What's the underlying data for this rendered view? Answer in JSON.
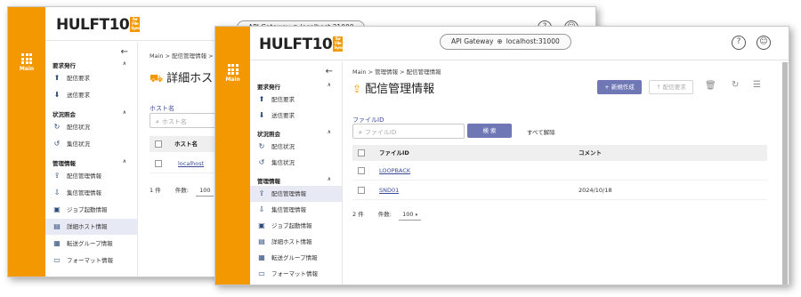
{
  "rail": {
    "label": "Main"
  },
  "app": {
    "logo": "HULFT10",
    "logo_badge": "for File Sync"
  },
  "gateway": {
    "label": "API Gateway",
    "host": "localhost:31000"
  },
  "header_icons": {
    "help": "?",
    "user": "user-icon"
  },
  "back": {
    "gateway_text": "API Gateway  ⊕  localhost:31000",
    "breadcrumb": "Main  >  配信管理情報  >  詳",
    "title": "詳細ホス",
    "search_label": "ホスト名",
    "search_placeholder": "ホスト名",
    "table_header": "ホスト名",
    "row1": "localhost",
    "count": "1 件",
    "per_page_label": "件数:",
    "per_page": "100",
    "sidebar": {
      "sections": [
        {
          "label": "要求発行",
          "items": [
            "配信要求",
            "送信要求"
          ]
        },
        {
          "label": "状況照会",
          "items": [
            "配信状況",
            "集信状況"
          ]
        },
        {
          "label": "管理情報",
          "items": [
            "配信管理情報",
            "集信管理情報",
            "ジョブ起動情報",
            "詳細ホスト情報",
            "転送グループ情報",
            "フォーマット情報"
          ]
        }
      ]
    }
  },
  "front": {
    "breadcrumb": "Main  >  管理情報  >  配信管理情報",
    "title": "配信管理情報",
    "buttons": {
      "new": "+ 新規作成",
      "request": "↑ 配信要求",
      "search": "検 索",
      "clear": "すべて解除"
    },
    "filter": {
      "label": "ファイルID",
      "placeholder": "ファイルID"
    },
    "table": {
      "columns": [
        "ファイルID",
        "コメント"
      ],
      "rows": [
        {
          "file_id": "LOOPBACK",
          "comment": ""
        },
        {
          "file_id": "SND01",
          "comment": "2024/10/18"
        }
      ]
    },
    "count": "2 件",
    "per_page_label": "件数:",
    "per_page": "100",
    "sidebar": {
      "sections": [
        {
          "label": "要求発行",
          "items": [
            "配信要求",
            "送信要求"
          ]
        },
        {
          "label": "状況照会",
          "items": [
            "配信状況",
            "集信状況"
          ]
        },
        {
          "label": "管理情報",
          "items": [
            "配信管理情報",
            "集信管理情報",
            "ジョブ起動情報",
            "詳細ホスト情報",
            "転送グループ情報",
            "フォーマット情報"
          ]
        }
      ]
    }
  },
  "colors": {
    "accent": "#f39800",
    "primary": "#6f77b5",
    "link": "#3b4a9a"
  }
}
